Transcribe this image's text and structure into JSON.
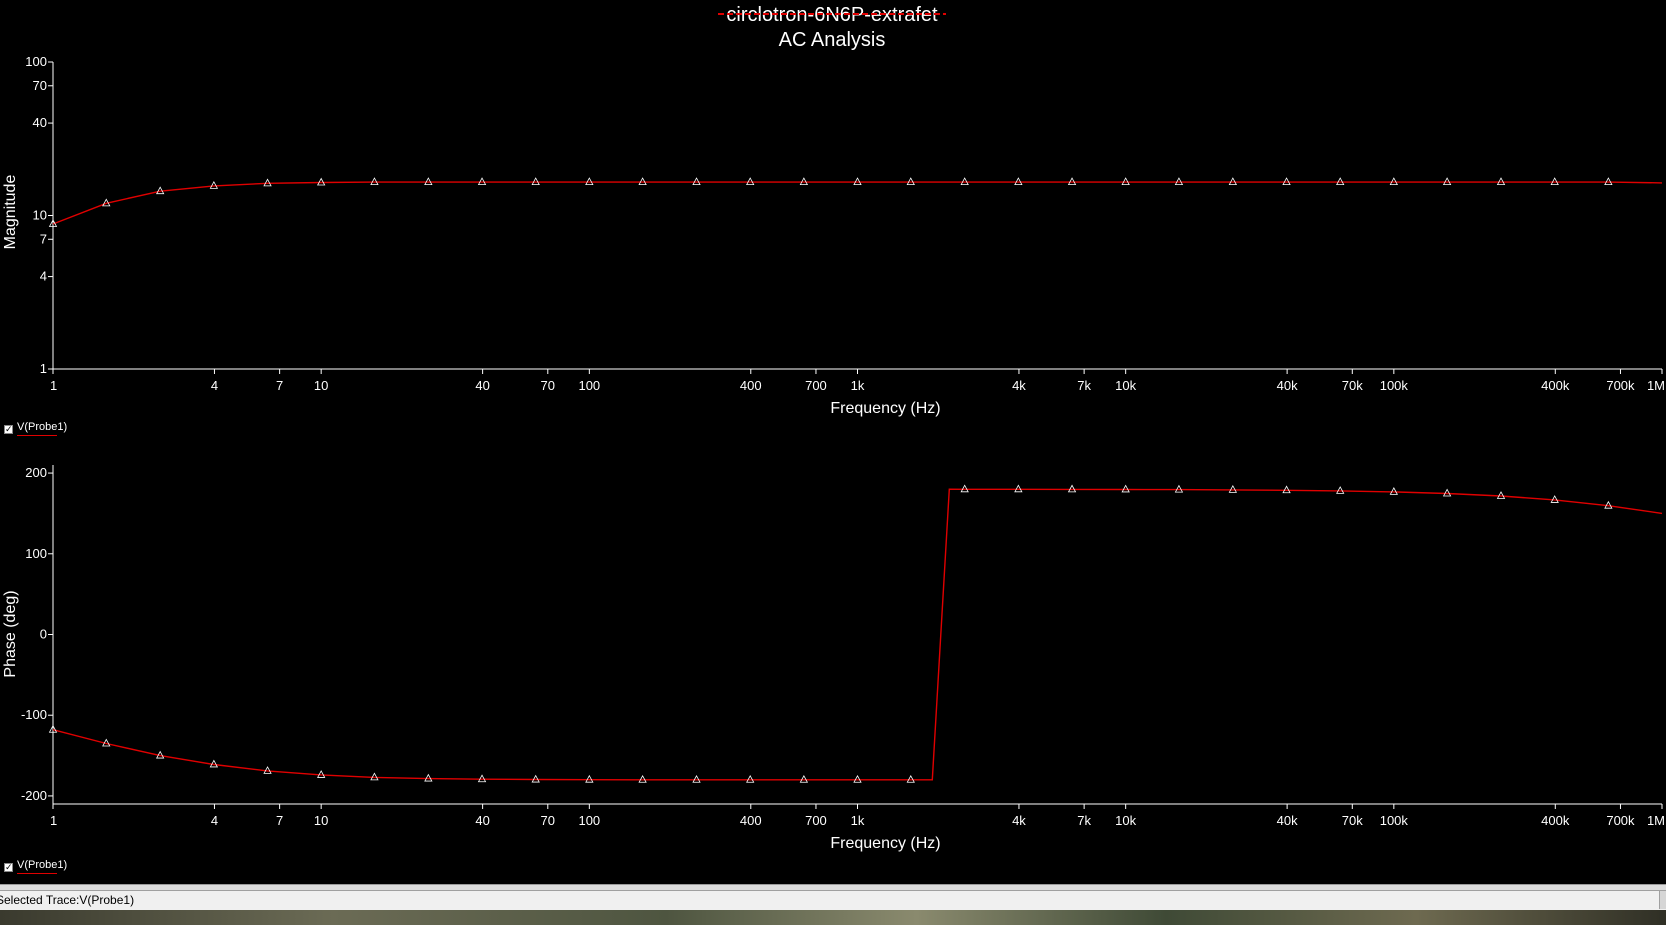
{
  "window": {
    "title": "circlotron-6N6P-extrafet",
    "subtitle": "AC Analysis",
    "status_text": "Selected Trace:V(Probe1)"
  },
  "legend": {
    "label": "V(Probe1)"
  },
  "colors": {
    "trace": "#e00000",
    "background": "#000000",
    "axis": "#ffffff"
  },
  "chart_data": [
    {
      "type": "line",
      "xlabel": "Frequency (Hz)",
      "ylabel": "Magnitude",
      "xscale": "log",
      "yscale": "log",
      "xlim": [
        1,
        1000000
      ],
      "ylim": [
        1,
        100
      ],
      "xticks": [
        "1",
        "4",
        "7",
        "10",
        "40",
        "70",
        "100",
        "400",
        "700",
        "1k",
        "4k",
        "7k",
        "10k",
        "40k",
        "70k",
        "100k",
        "400k",
        "700k",
        "1M"
      ],
      "yticks": [
        "1",
        "4",
        "7",
        "10",
        "40",
        "70",
        "100"
      ],
      "grid": false,
      "legend": "bottom-left",
      "series": [
        {
          "name": "V(Probe1)",
          "x": [
            1,
            1.58,
            2.51,
            3.98,
            6.31,
            10,
            15.8,
            25.1,
            39.8,
            63.1,
            100,
            158,
            251,
            398,
            631,
            1000,
            1580,
            2510,
            3980,
            6310,
            10000,
            15800,
            25100,
            39800,
            63100,
            100000,
            158000,
            251000,
            398000,
            631000,
            1000000
          ],
          "y": [
            8.8,
            12.0,
            14.4,
            15.6,
            16.2,
            16.4,
            16.5,
            16.5,
            16.5,
            16.5,
            16.5,
            16.5,
            16.5,
            16.5,
            16.5,
            16.5,
            16.5,
            16.5,
            16.5,
            16.5,
            16.5,
            16.5,
            16.5,
            16.5,
            16.5,
            16.5,
            16.5,
            16.5,
            16.5,
            16.5,
            16.3
          ]
        }
      ]
    },
    {
      "type": "line",
      "xlabel": "Frequency (Hz)",
      "ylabel": "Phase (deg)",
      "xscale": "log",
      "yscale": "linear",
      "xlim": [
        1,
        1000000
      ],
      "ylim": [
        -210,
        210
      ],
      "xticks": [
        "1",
        "4",
        "7",
        "10",
        "40",
        "70",
        "100",
        "400",
        "700",
        "1k",
        "4k",
        "7k",
        "10k",
        "40k",
        "70k",
        "100k",
        "400k",
        "700k",
        "1M"
      ],
      "yticks": [
        "-200",
        "-100",
        "0",
        "100",
        "200"
      ],
      "grid": false,
      "legend": "bottom-left",
      "series": [
        {
          "name": "V(Probe1)",
          "x": [
            1,
            1.58,
            2.51,
            3.98,
            6.31,
            10,
            15.8,
            25.1,
            39.8,
            63.1,
            100,
            158,
            251,
            398,
            631,
            1000,
            1580,
            1900,
            2200,
            2510,
            3980,
            6310,
            10000,
            15800,
            25100,
            39800,
            63100,
            100000,
            158000,
            251000,
            398000,
            631000,
            1000000
          ],
          "y": [
            -118,
            -135,
            -150,
            -161,
            -169,
            -174,
            -177,
            -178.5,
            -179.3,
            -179.7,
            -179.9,
            -180,
            -180,
            -180,
            -180,
            -180,
            -180,
            -180,
            180,
            179.9,
            179.9,
            179.8,
            179.7,
            179.5,
            179.2,
            178.7,
            177.9,
            176.7,
            174.7,
            171.6,
            166.7,
            159.6,
            150
          ]
        }
      ]
    }
  ]
}
